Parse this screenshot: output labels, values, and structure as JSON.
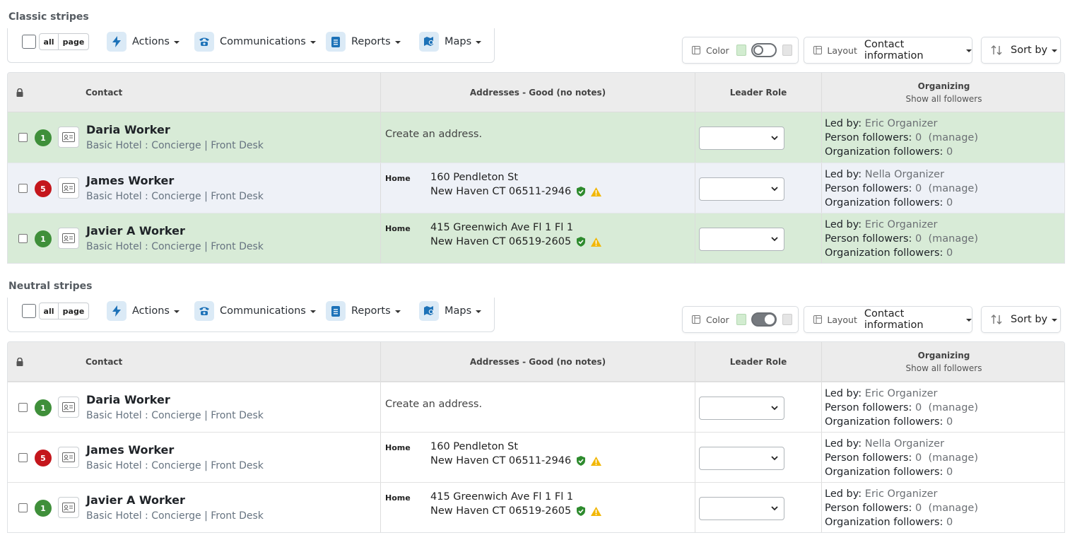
{
  "sections": [
    {
      "title": "Classic stripes",
      "toolbar": {
        "seg_all": "all",
        "seg_page": "page",
        "actions": "Actions",
        "communications": "Communications",
        "reports": "Reports",
        "maps": "Maps",
        "color_label": "Color",
        "layout_label": "Layout",
        "layout_value": "Contact information",
        "sort_label": "Sort by",
        "color_toggle_on": false
      },
      "headers": {
        "contact": "Contact",
        "addresses": "Addresses - Good (no notes)",
        "leader_role": "Leader Role",
        "organizing": "Organizing",
        "show_all": "Show all followers"
      },
      "rows": [
        {
          "badge": "1",
          "badge_color": "#3f8f3a",
          "name": "Daria Worker",
          "sub": "Basic Hotel : Concierge | Front Desk",
          "address_create": "Create an address.",
          "address_type": "",
          "line1": "",
          "line2": "",
          "led_by_label": "Led by:",
          "led_by": "Eric Organizer",
          "pf_label": "Person followers:",
          "pf": "0",
          "manage": "(manage)",
          "of_label": "Organization followers:",
          "of": "0"
        },
        {
          "badge": "5",
          "badge_color": "#c4161c",
          "name": "James Worker",
          "sub": "Basic Hotel : Concierge | Front Desk",
          "address_create": "",
          "address_type": "Home",
          "line1": "160 Pendleton St",
          "line2": "New Haven CT 06511-2946",
          "led_by_label": "Led by:",
          "led_by": "Nella Organizer",
          "pf_label": "Person followers:",
          "pf": "0",
          "manage": "(manage)",
          "of_label": "Organization followers:",
          "of": "0"
        },
        {
          "badge": "1",
          "badge_color": "#3f8f3a",
          "name": "Javier A Worker",
          "sub": "Basic Hotel : Concierge | Front Desk",
          "address_create": "",
          "address_type": "Home",
          "line1": "415 Greenwich Ave Fl 1 Fl 1",
          "line2": "New Haven CT 06519-2605",
          "led_by_label": "Led by:",
          "led_by": "Eric Organizer",
          "pf_label": "Person followers:",
          "pf": "0",
          "manage": "(manage)",
          "of_label": "Organization followers:",
          "of": "0"
        }
      ]
    },
    {
      "title": "Neutral stripes",
      "toolbar": {
        "seg_all": "all",
        "seg_page": "page",
        "actions": "Actions",
        "communications": "Communications",
        "reports": "Reports",
        "maps": "Maps",
        "color_label": "Color",
        "layout_label": "Layout",
        "layout_value": "Contact information",
        "sort_label": "Sort by",
        "color_toggle_on": true
      },
      "headers": {
        "contact": "Contact",
        "addresses": "Addresses - Good (no notes)",
        "leader_role": "Leader Role",
        "organizing": "Organizing",
        "show_all": "Show all followers"
      },
      "rows": [
        {
          "badge": "1",
          "badge_color": "#3f8f3a",
          "name": "Daria Worker",
          "sub": "Basic Hotel : Concierge | Front Desk",
          "address_create": "Create an address.",
          "address_type": "",
          "line1": "",
          "line2": "",
          "led_by_label": "Led by:",
          "led_by": "Eric Organizer",
          "pf_label": "Person followers:",
          "pf": "0",
          "manage": "(manage)",
          "of_label": "Organization followers:",
          "of": "0"
        },
        {
          "badge": "5",
          "badge_color": "#c4161c",
          "name": "James Worker",
          "sub": "Basic Hotel : Concierge | Front Desk",
          "address_create": "",
          "address_type": "Home",
          "line1": "160 Pendleton St",
          "line2": "New Haven CT 06511-2946",
          "led_by_label": "Led by:",
          "led_by": "Nella Organizer",
          "pf_label": "Person followers:",
          "pf": "0",
          "manage": "(manage)",
          "of_label": "Organization followers:",
          "of": "0"
        },
        {
          "badge": "1",
          "badge_color": "#3f8f3a",
          "name": "Javier A Worker",
          "sub": "Basic Hotel : Concierge | Front Desk",
          "address_create": "",
          "address_type": "Home",
          "line1": "415 Greenwich Ave Fl 1 Fl 1",
          "line2": "New Haven CT 06519-2605",
          "led_by_label": "Led by:",
          "led_by": "Eric Organizer",
          "pf_label": "Person followers:",
          "pf": "0",
          "manage": "(manage)",
          "of_label": "Organization followers:",
          "of": "0"
        }
      ]
    }
  ],
  "icons": {
    "lock": "lock-icon",
    "actions": "bolt-icon",
    "communications": "phone-icon",
    "reports": "report-icon",
    "maps": "map-icon",
    "verified": "shield-check-icon",
    "warning": "warning-icon",
    "contact_card": "id-card-icon"
  },
  "colors": {
    "accent": "#1d72b8",
    "badge_green": "#3f8f3a",
    "badge_red": "#c4161c",
    "classic_stripe_green": "#d8ebd7",
    "classic_stripe_alt": "#eef1f7",
    "verified_green": "#2e8b2e",
    "warning_yellow": "#f2b705"
  }
}
